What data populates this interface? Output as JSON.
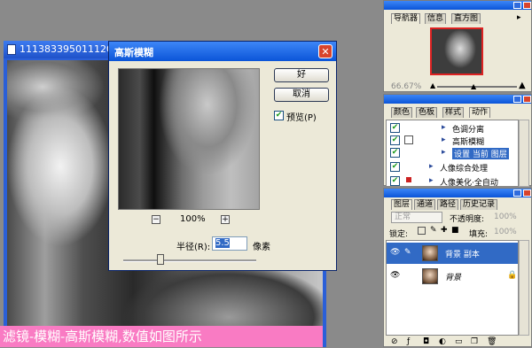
{
  "document": {
    "title": "1113833950111201"
  },
  "dialog": {
    "title": "高斯模糊",
    "zoom": "100%",
    "zoom_out": "−",
    "zoom_in": "+",
    "ok_label": "好",
    "cancel_label": "取消",
    "preview_label": "预览(P)",
    "preview_checked": true,
    "radius_label": "半径(R):",
    "radius_value": "5.5",
    "radius_unit": "像素"
  },
  "caption": "滤镜-模糊-高斯模糊,数值如图所示",
  "navigator": {
    "tabs": [
      "导航器",
      "信息",
      "直方图"
    ],
    "zoom": "66.67%"
  },
  "actions": {
    "tabs": [
      "颜色",
      "色板",
      "样式",
      "动作"
    ],
    "items": [
      "色调分离",
      "高斯模糊",
      "设置 当前 图层",
      "人像综合处理",
      "人像美化·全自动"
    ]
  },
  "layers": {
    "tabs": [
      "图层",
      "通道",
      "路径",
      "历史记录"
    ],
    "blend_mode": "正常",
    "opacity_label": "不透明度:",
    "opacity_value": "100%",
    "lock_label": "锁定:",
    "fill_label": "填充:",
    "fill_value": "100%",
    "items": [
      {
        "name": "背景 副本",
        "selected": true
      },
      {
        "name": "背景",
        "selected": false
      }
    ]
  },
  "colors": {
    "title_bar": "#0b55d8",
    "caption_bg": "#f97bc3",
    "close": "#d8442c",
    "selection": "#316ac5"
  }
}
